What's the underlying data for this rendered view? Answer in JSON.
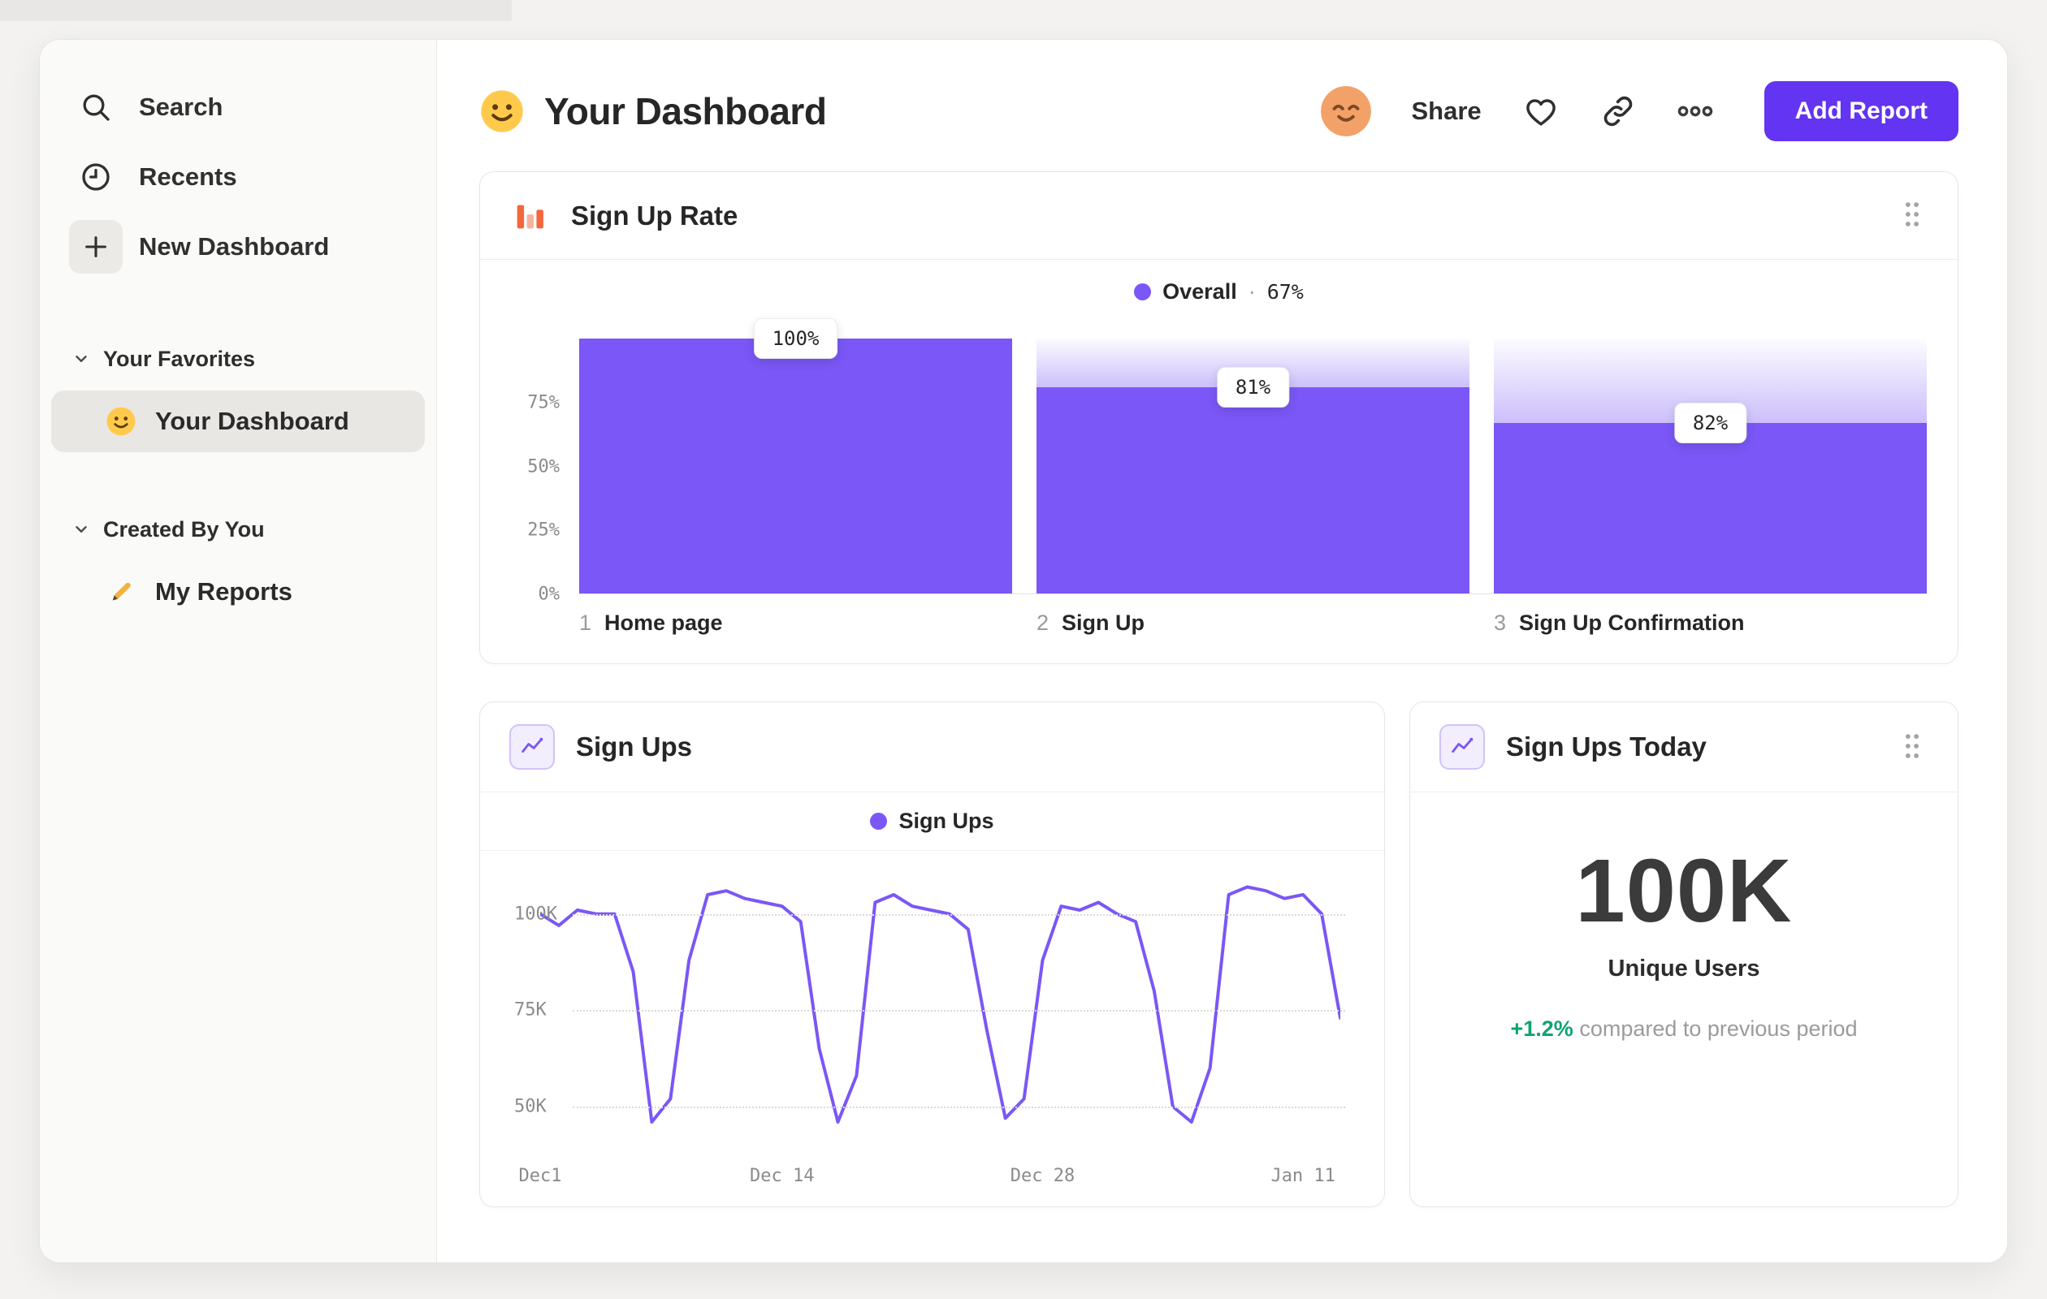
{
  "colors": {
    "accent_purple": "#7A57F6",
    "button_purple": "#6334F1",
    "icon_orange": "#F2673C",
    "delta_green": "#0EA372"
  },
  "sidebar": {
    "items": [
      {
        "label": "Search",
        "icon": "search-icon"
      },
      {
        "label": "Recents",
        "icon": "clock-icon"
      },
      {
        "label": "New Dashboard",
        "icon": "plus-icon"
      }
    ],
    "sections": [
      {
        "title": "Your Favorites",
        "items": [
          {
            "label": "Your Dashboard",
            "icon": "smiley-emoji",
            "selected": true
          }
        ]
      },
      {
        "title": "Created By You",
        "items": [
          {
            "label": "My Reports",
            "icon": "pencil-icon",
            "selected": false
          }
        ]
      }
    ]
  },
  "header": {
    "title": "Your Dashboard",
    "share_label": "Share",
    "add_report_label": "Add Report"
  },
  "chart_data": [
    {
      "type": "bar",
      "title": "Sign Up Rate",
      "legend": {
        "label": "Overall",
        "sep": "·",
        "value": "67%"
      },
      "y_ticks": [
        {
          "label": "75%",
          "pct": 75
        },
        {
          "label": "50%",
          "pct": 50
        },
        {
          "label": "25%",
          "pct": 25
        },
        {
          "label": "0%",
          "pct": 0
        }
      ],
      "steps": [
        {
          "index": "1",
          "label": "Home page",
          "conversion_label": "100%",
          "overall_pct": 100
        },
        {
          "index": "2",
          "label": "Sign Up",
          "conversion_label": "81%",
          "overall_pct": 81
        },
        {
          "index": "3",
          "label": "Sign Up Confirmation",
          "conversion_label": "82%",
          "overall_pct": 67
        }
      ],
      "ylim": [
        0,
        100
      ],
      "bar_color": "#7A57F6"
    },
    {
      "type": "line",
      "title": "Sign Ups",
      "legend": {
        "label": "Sign Ups"
      },
      "unit": "K",
      "y_ticks": [
        {
          "label": "100K",
          "value": 100
        },
        {
          "label": "75K",
          "value": 75
        },
        {
          "label": "50K",
          "value": 50
        }
      ],
      "x_ticks": [
        {
          "label": "Dec1",
          "day": 0
        },
        {
          "label": "Dec 14",
          "day": 13
        },
        {
          "label": "Dec 28",
          "day": 27
        },
        {
          "label": "Jan 11",
          "day": 41
        }
      ],
      "values": [
        100,
        97,
        101,
        100,
        100,
        85,
        46,
        52,
        88,
        105,
        106,
        104,
        103,
        102,
        98,
        65,
        46,
        58,
        103,
        105,
        102,
        101,
        100,
        96,
        70,
        47,
        52,
        88,
        102,
        101,
        103,
        100,
        98,
        80,
        50,
        46,
        60,
        105,
        107,
        106,
        104,
        105,
        100,
        73
      ],
      "ylim": [
        38,
        113
      ],
      "line_color": "#7A57F6"
    },
    {
      "type": "metric",
      "title": "Sign Ups Today",
      "value": "100K",
      "label": "Unique Users",
      "delta": "+1.2%",
      "delta_note": "compared to previous period"
    }
  ]
}
